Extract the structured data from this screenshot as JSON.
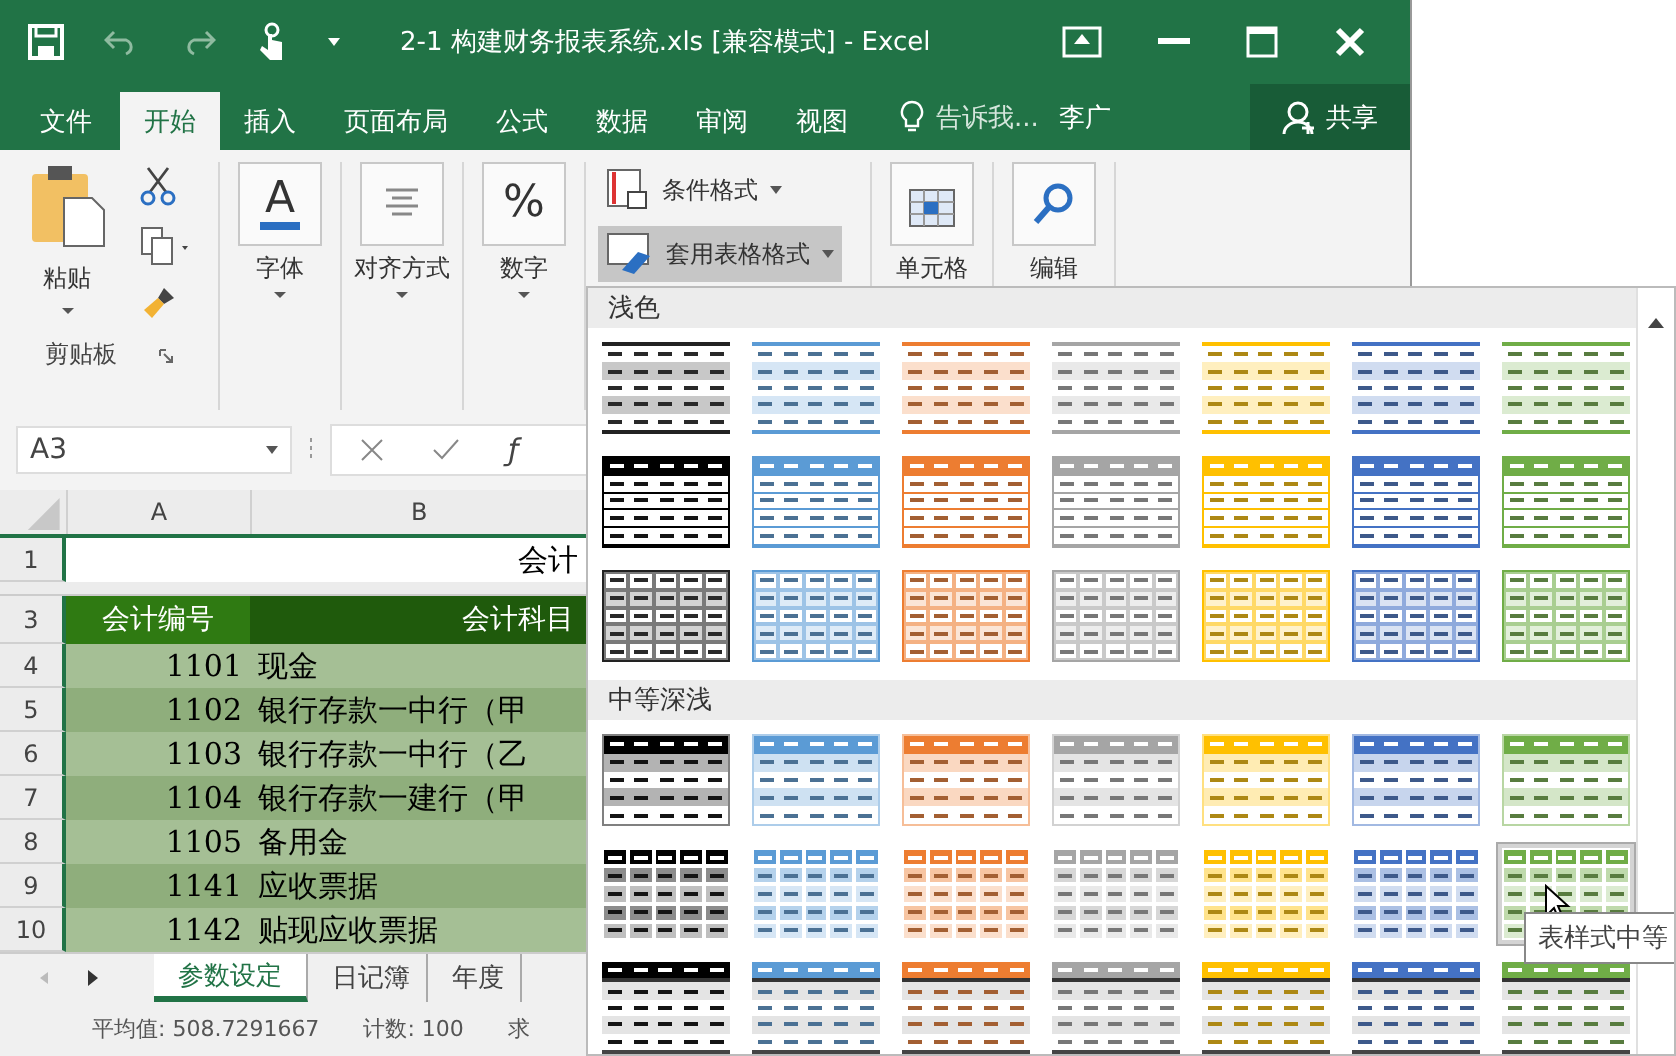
{
  "window": {
    "title": "2-1 构建财务报表系统.xls [兼容模式] - Excel"
  },
  "ribbon_tabs": [
    {
      "label": "文件",
      "selected": false
    },
    {
      "label": "开始",
      "selected": true
    },
    {
      "label": "插入",
      "selected": false
    },
    {
      "label": "页面布局",
      "selected": false
    },
    {
      "label": "公式",
      "selected": false
    },
    {
      "label": "数据",
      "selected": false
    },
    {
      "label": "审阅",
      "selected": false
    },
    {
      "label": "视图",
      "selected": false
    }
  ],
  "tell_me": "告诉我...",
  "user": "李广",
  "share_button": "共享",
  "clipboard": {
    "paste": "粘贴",
    "group_label": "剪贴板"
  },
  "ribbon_buttons": [
    {
      "kind": "font",
      "glyph": "A",
      "label": "字体"
    },
    {
      "kind": "align",
      "label": "对齐方式"
    },
    {
      "kind": "number",
      "glyph": "%",
      "label": "数字"
    }
  ],
  "style_commands": [
    {
      "label": "条件格式",
      "selected": false
    },
    {
      "label": "套用表格格式",
      "selected": true
    }
  ],
  "ribbon_buttons_right": [
    {
      "kind": "cells",
      "label": "单元格"
    },
    {
      "kind": "edit",
      "label": "编辑"
    }
  ],
  "formula_bar": {
    "name_box": "A3",
    "function_label": "ƒ"
  },
  "sheet": {
    "columns": [
      "A",
      "B"
    ],
    "rows": [
      {
        "num": "1",
        "kind": "title",
        "name": "会计"
      },
      {
        "num": "3",
        "kind": "header",
        "code": "会计编号",
        "name": "会计科目"
      },
      {
        "num": "4",
        "kind": "data",
        "code": "1101",
        "name": "现金"
      },
      {
        "num": "5",
        "kind": "data",
        "code": "1102",
        "name": "银行存款一中行（甲"
      },
      {
        "num": "6",
        "kind": "data",
        "code": "1103",
        "name": "银行存款一中行（乙"
      },
      {
        "num": "7",
        "kind": "data",
        "code": "1104",
        "name": "银行存款一建行（甲"
      },
      {
        "num": "8",
        "kind": "data",
        "code": "1105",
        "name": "备用金"
      },
      {
        "num": "9",
        "kind": "data",
        "code": "1141",
        "name": "应收票据"
      },
      {
        "num": "10",
        "kind": "data",
        "code": "1142",
        "name": "贴现应收票据"
      }
    ]
  },
  "sheet_tabs": [
    {
      "label": "参数设定",
      "selected": true
    },
    {
      "label": "日记簿",
      "selected": false
    },
    {
      "label": "年度",
      "selected": false
    }
  ],
  "status_bar": [
    "平均值: 508.7291667",
    "计数: 100",
    "求"
  ],
  "gallery": {
    "sections": [
      {
        "title": "浅色",
        "rows": [
          {
            "kind": "lines",
            "styles": [
              {
                "color": "#222222",
                "selected": false
              },
              {
                "color": "#5b9bd5",
                "selected": false
              },
              {
                "color": "#ed7d31",
                "selected": false
              },
              {
                "color": "#a5a5a5",
                "selected": false
              },
              {
                "color": "#ffc000",
                "selected": false
              },
              {
                "color": "#4472c4",
                "selected": false
              },
              {
                "color": "#70ad47",
                "selected": false
              }
            ]
          },
          {
            "kind": "header",
            "styles": [
              {
                "color": "#000000",
                "selected": false
              },
              {
                "color": "#5b9bd5",
                "selected": false
              },
              {
                "color": "#ed7d31",
                "selected": false
              },
              {
                "color": "#a5a5a5",
                "selected": false
              },
              {
                "color": "#ffc000",
                "selected": false
              },
              {
                "color": "#4472c4",
                "selected": false
              },
              {
                "color": "#70ad47",
                "selected": false
              }
            ]
          },
          {
            "kind": "grid",
            "styles": [
              {
                "color": "#222222",
                "selected": false
              },
              {
                "color": "#5b9bd5",
                "selected": false
              },
              {
                "color": "#ed7d31",
                "selected": false
              },
              {
                "color": "#a5a5a5",
                "selected": false
              },
              {
                "color": "#ffc000",
                "selected": false
              },
              {
                "color": "#4472c4",
                "selected": false
              },
              {
                "color": "#70ad47",
                "selected": false
              }
            ]
          }
        ]
      },
      {
        "title": "中等深浅",
        "rows": [
          {
            "kind": "banded",
            "styles": [
              {
                "color": "#000000",
                "selected": false
              },
              {
                "color": "#5b9bd5",
                "selected": false
              },
              {
                "color": "#ed7d31",
                "selected": false
              },
              {
                "color": "#a5a5a5",
                "selected": false
              },
              {
                "color": "#ffc000",
                "selected": false
              },
              {
                "color": "#4472c4",
                "selected": false
              },
              {
                "color": "#70ad47",
                "selected": false
              }
            ]
          },
          {
            "kind": "filled",
            "styles": [
              {
                "color": "#000000",
                "selected": false
              },
              {
                "color": "#5b9bd5",
                "selected": false
              },
              {
                "color": "#ed7d31",
                "selected": false
              },
              {
                "color": "#a5a5a5",
                "selected": false
              },
              {
                "color": "#ffc000",
                "selected": false
              },
              {
                "color": "#4472c4",
                "selected": false
              },
              {
                "color": "#70ad47",
                "selected": true
              }
            ]
          },
          {
            "kind": "dark",
            "styles": [
              {
                "color": "#000000",
                "selected": false
              },
              {
                "color": "#5b9bd5",
                "selected": false
              },
              {
                "color": "#ed7d31",
                "selected": false
              },
              {
                "color": "#a5a5a5",
                "selected": false
              },
              {
                "color": "#ffc000",
                "selected": false
              },
              {
                "color": "#4472c4",
                "selected": false
              },
              {
                "color": "#70ad47",
                "selected": false
              }
            ]
          }
        ]
      }
    ],
    "tooltip": "表样式中等"
  }
}
